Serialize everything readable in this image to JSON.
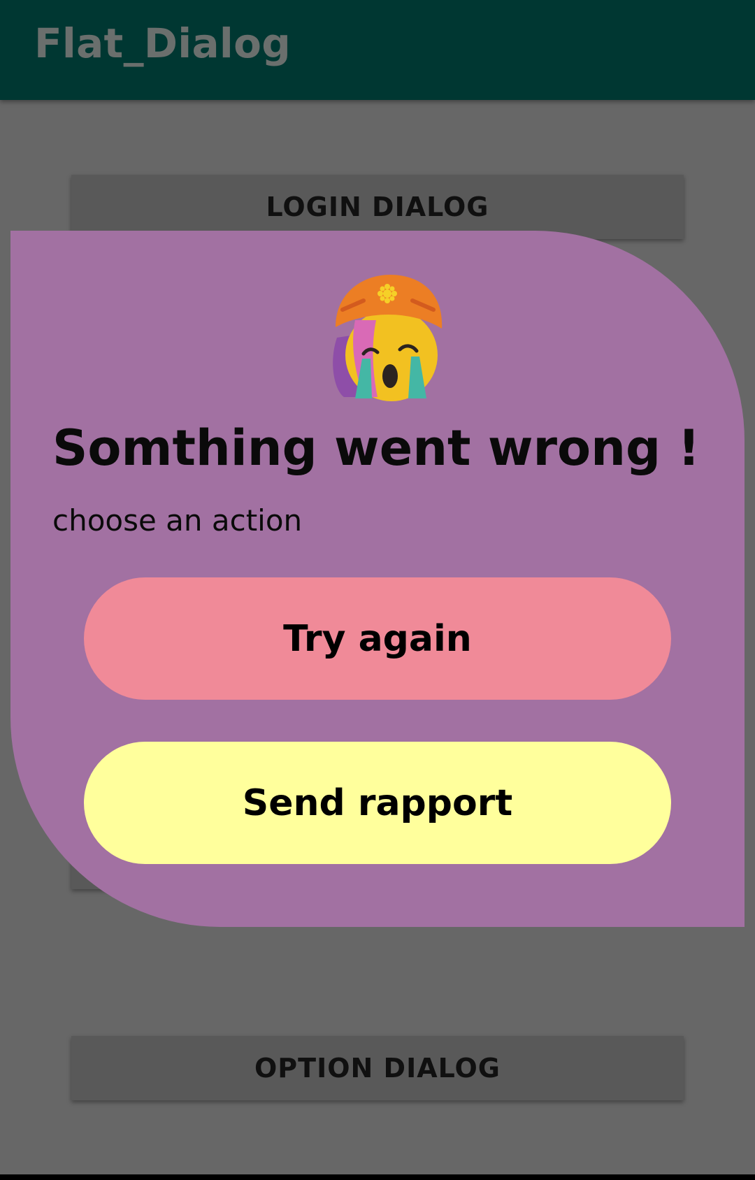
{
  "app": {
    "title": "Flat_Dialog"
  },
  "background_buttons": {
    "login": "LOGIN DIALOG",
    "option": "OPTION DIALOG"
  },
  "dialog": {
    "icon": "crying-face-emoji-icon",
    "title": "Somthing went wrong !",
    "subtitle": "choose an action",
    "primary_label": "Try again",
    "secondary_label": "Send rapport"
  },
  "colors": {
    "appbar": "#003732",
    "scrim": "#676767",
    "dialog": "#a271a2",
    "try_again": "#f08a98",
    "send_rapport": "#ffff9c"
  }
}
